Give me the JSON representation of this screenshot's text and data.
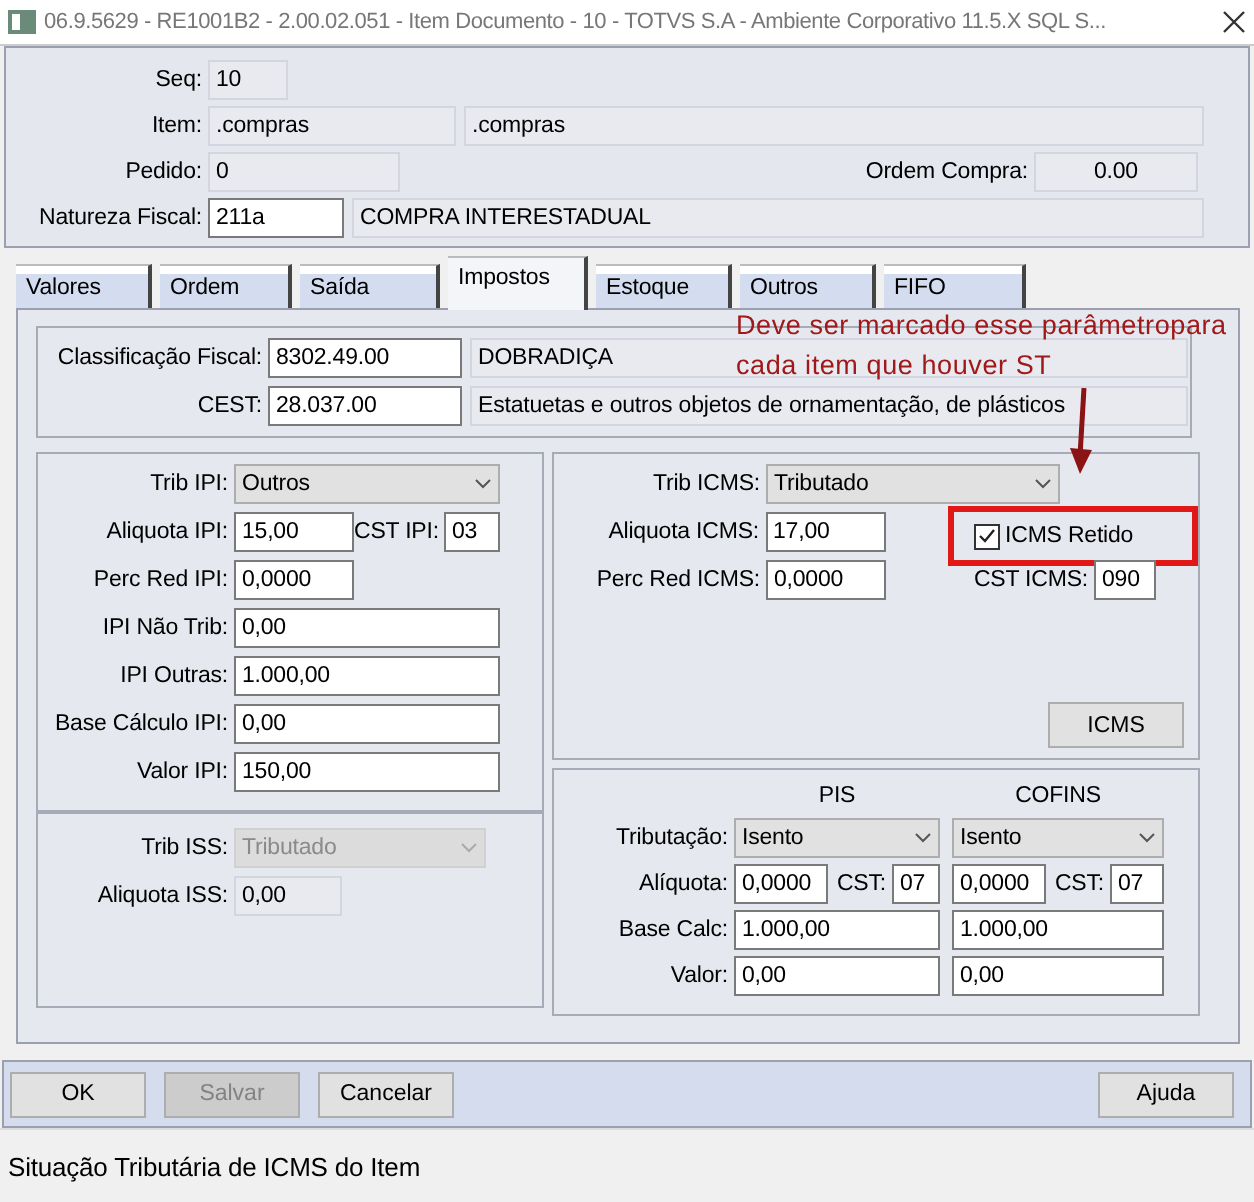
{
  "window": {
    "title": "06.9.5629 - RE1001B2 - 2.00.02.051 - Item Documento - 10 - TOTVS S.A - Ambiente Corporativo 11.5.X SQL S..."
  },
  "header": {
    "seq": {
      "label": "Seq:",
      "field": {
        "value": "10",
        "readonly": true
      }
    },
    "item": {
      "label": "Item:",
      "code": {
        "value": ".compras",
        "readonly": true
      },
      "description": {
        "value": ".compras",
        "readonly": true
      }
    },
    "pedido": {
      "label": "Pedido:",
      "field": {
        "value": "0",
        "readonly": true
      }
    },
    "ordem_compra": {
      "label": "Ordem Compra:",
      "field": {
        "value": "0.00",
        "readonly": true
      }
    },
    "natureza_fiscal": {
      "label": "Natureza Fiscal:",
      "code": {
        "value": "211a",
        "readonly": false
      },
      "description": {
        "value": "COMPRA INTERESTADUAL",
        "readonly": true
      }
    }
  },
  "tabs": [
    {
      "label": "Valores",
      "selected": false
    },
    {
      "label": "Ordem",
      "selected": false
    },
    {
      "label": "Saída",
      "selected": false
    },
    {
      "label": "Impostos",
      "selected": true
    },
    {
      "label": "Estoque",
      "selected": false
    },
    {
      "label": "Outros",
      "selected": false
    },
    {
      "label": "FIFO",
      "selected": false
    }
  ],
  "classificacao": {
    "fiscal": {
      "label": "Classificação Fiscal:",
      "code": {
        "value": "8302.49.00",
        "readonly": false
      },
      "description": {
        "value": "DOBRADIÇA",
        "readonly": true
      }
    },
    "cest": {
      "label": "CEST:",
      "code": {
        "value": "28.037.00",
        "readonly": false
      },
      "description": {
        "value": "Estatuetas e outros objetos de ornamentação, de plásticos",
        "readonly": true
      }
    }
  },
  "ipi": {
    "trib": {
      "label": "Trib IPI:",
      "value": "Outros",
      "disabled": false
    },
    "aliquota": {
      "label": "Aliquota IPI:",
      "field": {
        "value": "15,00",
        "readonly": false
      }
    },
    "cst": {
      "label": "CST IPI:",
      "field": {
        "value": "03",
        "readonly": false
      }
    },
    "perc_red": {
      "label": "Perc Red IPI:",
      "field": {
        "value": "0,0000",
        "readonly": false
      }
    },
    "nao_trib": {
      "label": "IPI Não Trib:",
      "field": {
        "value": "0,00",
        "readonly": false
      }
    },
    "outras": {
      "label": "IPI Outras:",
      "field": {
        "value": "1.000,00",
        "readonly": false
      }
    },
    "base_calculo": {
      "label": "Base Cálculo IPI:",
      "field": {
        "value": "0,00",
        "readonly": false
      }
    },
    "valor": {
      "label": "Valor IPI:",
      "field": {
        "value": "150,00",
        "readonly": false
      }
    }
  },
  "iss": {
    "trib": {
      "label": "Trib ISS:",
      "value": "Tributado",
      "disabled": true
    },
    "aliquota": {
      "label": "Aliquota ISS:",
      "field": {
        "value": "0,00",
        "readonly": true
      }
    }
  },
  "icms": {
    "trib": {
      "label": "Trib ICMS:",
      "value": "Tributado",
      "disabled": false
    },
    "aliquota": {
      "label": "Aliquota ICMS:",
      "field": {
        "value": "17,00",
        "readonly": false
      }
    },
    "retido": {
      "label": "ICMS Retido",
      "checked": true,
      "highlighted": true
    },
    "perc_red": {
      "label": "Perc Red ICMS:",
      "field": {
        "value": "0,0000",
        "readonly": false
      }
    },
    "cst": {
      "label": "CST ICMS:",
      "field": {
        "value": "090",
        "readonly": false
      }
    },
    "button": "ICMS"
  },
  "pis_cofins": {
    "columns": [
      {
        "heading": "PIS",
        "cst_label": "CST:",
        "tributacao": {
          "value": "Isento",
          "disabled": false
        },
        "aliquota": {
          "value": "0,0000",
          "readonly": false
        },
        "cst": {
          "value": "07",
          "readonly": false
        },
        "base_calc": {
          "value": "1.000,00",
          "readonly": false
        },
        "valor": {
          "value": "0,00",
          "readonly": false
        }
      },
      {
        "heading": "COFINS",
        "cst_label": "CST:",
        "tributacao": {
          "value": "Isento",
          "disabled": false
        },
        "aliquota": {
          "value": "0,0000",
          "readonly": false
        },
        "cst": {
          "value": "07",
          "readonly": false
        },
        "base_calc": {
          "value": "1.000,00",
          "readonly": false
        },
        "valor": {
          "value": "0,00",
          "readonly": false
        }
      }
    ],
    "labels": {
      "tributacao": "Tributação:",
      "aliquota": "Alíquota:",
      "base_calc": "Base Calc:",
      "valor": "Valor:"
    }
  },
  "annotation": {
    "lines": [
      "Deve ser marcado esse parâmetropara",
      "cada item que houver ST"
    ]
  },
  "buttons": [
    {
      "label": "OK",
      "disabled": false
    },
    {
      "label": "Salvar",
      "disabled": true
    },
    {
      "label": "Cancelar",
      "disabled": false
    },
    {
      "label": "Ajuda",
      "disabled": false
    }
  ],
  "status_bar": "Situação Tributária de ICMS do Item"
}
